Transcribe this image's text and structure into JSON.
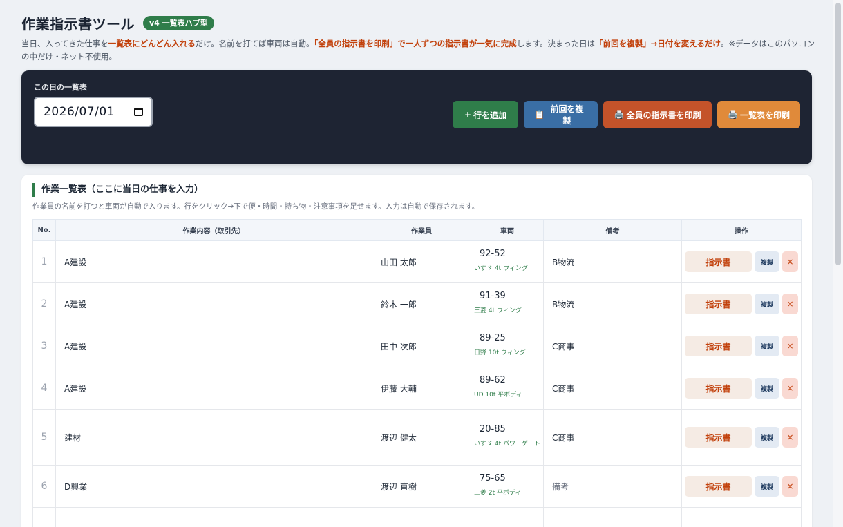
{
  "header": {
    "title": "作業指示書ツール",
    "badge": "v4 一覧表ハブ型",
    "desc_parts": [
      {
        "text": "当日、入ってきた仕事を",
        "hl": false
      },
      {
        "text": "一覧表にどんどん入れる",
        "hl": true
      },
      {
        "text": "だけ。名前を打てば車両は自動。",
        "hl": false
      },
      {
        "text": "「全員の指示書を印刷」で一人ずつの指示書が一気に完成",
        "hl": true
      },
      {
        "text": "します。決まった日は",
        "hl": false
      },
      {
        "text": "「前回を複製」→日付を変えるだけ",
        "hl": true
      },
      {
        "text": "。※データはこのパソコンの中だけ・ネット不使用。",
        "hl": false
      }
    ]
  },
  "control": {
    "date_label": "この日の一覧表",
    "date_value": "2026/07/01",
    "buttons": {
      "add": {
        "icon": "+",
        "label": "行を追加"
      },
      "copy": {
        "icon": "📋",
        "label": "前回を複製"
      },
      "print_all": {
        "icon": "🖨️",
        "label": "全員の指示書を印刷"
      },
      "print_list": {
        "icon": "🖨️",
        "label": "一覧表を印刷"
      }
    }
  },
  "table": {
    "title": "作業一覧表（ここに当日の仕事を入力）",
    "hint": "作業員の名前を打つと車両が自動で入ります。行をクリック→下で便・時間・持ち物・注意事項を足せます。入力は自動で保存されます。",
    "columns": [
      "No.",
      "作業内容（取引先）",
      "作業員",
      "車両",
      "備考",
      "操作"
    ],
    "op_labels": {
      "doc": "指示書",
      "dup": "複製",
      "del": "×"
    },
    "rows": [
      {
        "no": "1",
        "job": "A建設",
        "worker": "山田 太郎",
        "vnum": "92-52",
        "vtype": "いすゞ 4t ウィング",
        "memo": "B物流",
        "memo_placeholder": false
      },
      {
        "no": "2",
        "job": "A建設",
        "worker": "鈴木 一郎",
        "vnum": "91-39",
        "vtype": "三菱 4t ウィング",
        "memo": "B物流",
        "memo_placeholder": false
      },
      {
        "no": "3",
        "job": "A建設",
        "worker": "田中 次郎",
        "vnum": "89-25",
        "vtype": "日野 10t ウィング",
        "memo": "C商事",
        "memo_placeholder": false
      },
      {
        "no": "4",
        "job": "A建設",
        "worker": "伊藤 大輔",
        "vnum": "89-62",
        "vtype": "UD 10t 平ボディ",
        "memo": "C商事",
        "memo_placeholder": false
      },
      {
        "no": "5",
        "job": "建材",
        "worker": "渡辺 健太",
        "vnum": "20-85",
        "vtype": "いすゞ 4t パワーゲート",
        "memo": "C商事",
        "memo_placeholder": false
      },
      {
        "no": "6",
        "job": "D興業",
        "worker": "渡辺 直樹",
        "vnum": "75-65",
        "vtype": "三菱 2t 平ボディ",
        "memo": "備考",
        "memo_placeholder": true
      }
    ]
  },
  "colors": {
    "accent_green": "#2f7d4a",
    "accent_blue": "#3a6ea5",
    "accent_red": "#c4532a",
    "accent_orange": "#e08a3a",
    "panel_dark": "#1e2433"
  }
}
